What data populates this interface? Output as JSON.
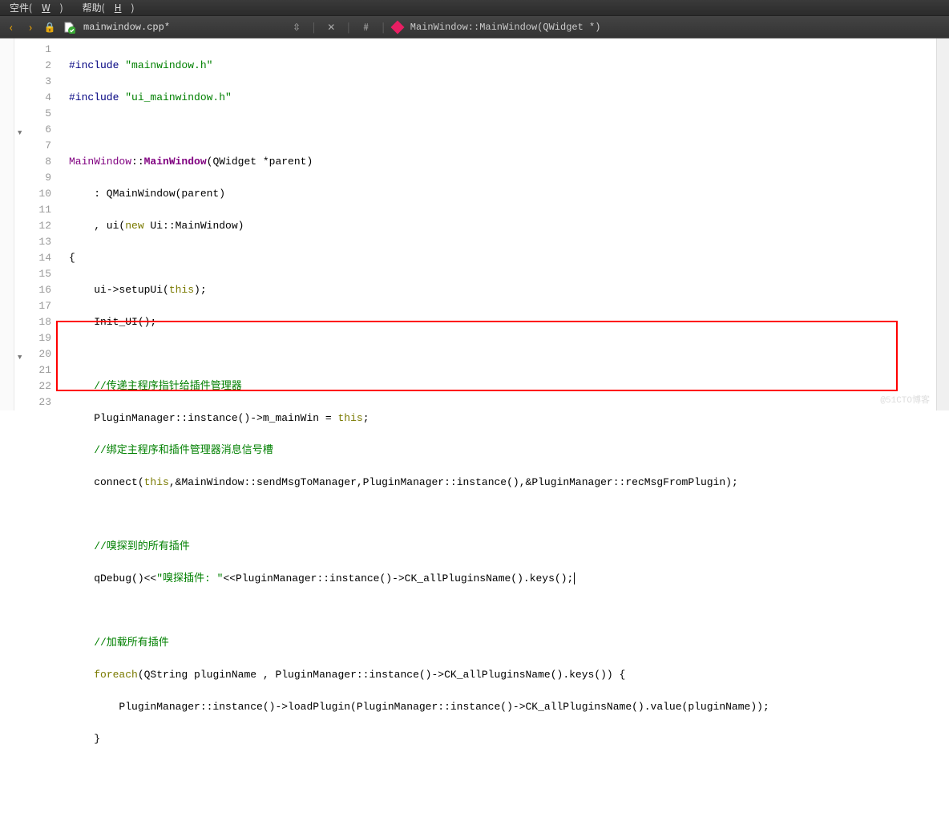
{
  "menubar": {
    "item1_pre": "空件(",
    "item1_hint": "W",
    "item1_post": ")",
    "item2_pre": "帮助(",
    "item2_hint": "H",
    "item2_post": ")"
  },
  "toolbar": {
    "filename": "mainwindow.cpp*",
    "updown": "⇳",
    "close": "✕",
    "hash": "#",
    "breadcrumb": "MainWindow::MainWindow(QWidget *)"
  },
  "gutter": [
    "1",
    "2",
    "3",
    "4",
    "5",
    "6",
    "7",
    "8",
    "9",
    "10",
    "11",
    "12",
    "13",
    "14",
    "15",
    "16",
    "17",
    "18",
    "19",
    "20",
    "21",
    "22",
    "23"
  ],
  "code": {
    "l1_a": "#include ",
    "l1_b": "\"mainwindow.h\"",
    "l2_a": "#include ",
    "l2_b": "\"ui_mainwindow.h\"",
    "l4_a": "MainWindow",
    "l4_b": "::",
    "l4_c": "MainWindow",
    "l4_d": "(QWidget *parent)",
    "l5": "    : QMainWindow(parent)",
    "l6_a": "    , ui(",
    "l6_b": "new",
    "l6_c": " Ui::MainWindow)",
    "l7": "{",
    "l8": "    ui->setupUi(",
    "l8_b": "this",
    "l8_c": ");",
    "l9": "    Init_UI();",
    "l11": "    //传递主程序指针给插件管理器",
    "l12_a": "    PluginManager::instance()->m_mainWin = ",
    "l12_b": "this",
    "l12_c": ";",
    "l13": "    //绑定主程序和插件管理器消息信号槽",
    "l14_a": "    connect(",
    "l14_b": "this",
    "l14_c": ",&MainWindow::sendMsgToManager,PluginManager::instance(),&PluginManager::recMsgFromPlugin);",
    "l16": "    //嗅探到的所有插件",
    "l17_a": "    qDebug()<<",
    "l17_b": "\"嗅探插件: \"",
    "l17_c": "<<PluginManager::instance()->CK_allPluginsName().keys();",
    "l19": "    //加载所有插件",
    "l20_a": "    ",
    "l20_b": "foreach",
    "l20_c": "(QString pluginName , PluginManager::instance()->CK_allPluginsName().keys()) {",
    "l21": "        PluginManager::instance()->loadPlugin(PluginManager::instance()->CK_allPluginsName().value(pluginName));",
    "l22": "    }"
  },
  "watermark": "@51CTO博客"
}
